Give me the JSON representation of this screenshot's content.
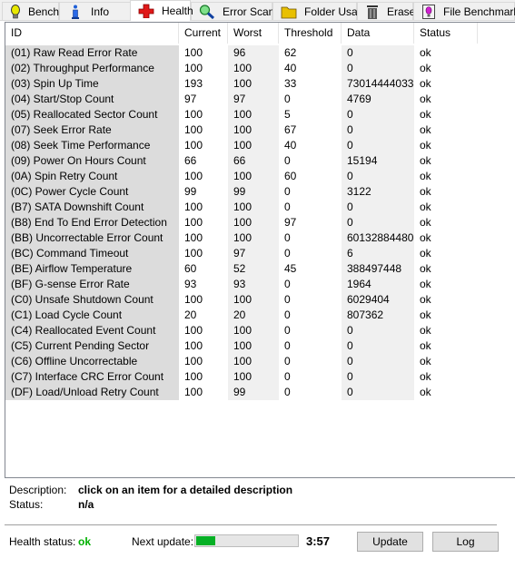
{
  "tabs": [
    {
      "label": "Benchmark",
      "icon": "lightbulb-icon",
      "active": false
    },
    {
      "label": "Info",
      "icon": "info-icon",
      "active": false
    },
    {
      "label": "Health",
      "icon": "health-cross-icon",
      "active": true
    },
    {
      "label": "Error Scan",
      "icon": "magnifier-icon",
      "active": false
    },
    {
      "label": "Folder Usage",
      "icon": "folder-icon",
      "active": false
    },
    {
      "label": "Erase",
      "icon": "trash-icon",
      "active": false
    },
    {
      "label": "File Benchmark",
      "icon": "file-benchmark-icon",
      "active": false
    }
  ],
  "table": {
    "columns": [
      "ID",
      "Current",
      "Worst",
      "Threshold",
      "Data",
      "Status"
    ],
    "rows": [
      [
        "(01) Raw Read Error Rate",
        "100",
        "96",
        "62",
        "0",
        "ok"
      ],
      [
        "(02) Throughput Performance",
        "100",
        "100",
        "40",
        "0",
        "ok"
      ],
      [
        "(03) Spin Up Time",
        "193",
        "100",
        "33",
        "73014444033",
        "ok"
      ],
      [
        "(04) Start/Stop Count",
        "97",
        "97",
        "0",
        "4769",
        "ok"
      ],
      [
        "(05) Reallocated Sector Count",
        "100",
        "100",
        "5",
        "0",
        "ok"
      ],
      [
        "(07) Seek Error Rate",
        "100",
        "100",
        "67",
        "0",
        "ok"
      ],
      [
        "(08) Seek Time Performance",
        "100",
        "100",
        "40",
        "0",
        "ok"
      ],
      [
        "(09) Power On Hours Count",
        "66",
        "66",
        "0",
        "15194",
        "ok"
      ],
      [
        "(0A) Spin Retry Count",
        "100",
        "100",
        "60",
        "0",
        "ok"
      ],
      [
        "(0C) Power Cycle Count",
        "99",
        "99",
        "0",
        "3122",
        "ok"
      ],
      [
        "(B7) SATA Downshift Count",
        "100",
        "100",
        "0",
        "0",
        "ok"
      ],
      [
        "(B8) End To End Error Detection",
        "100",
        "100",
        "97",
        "0",
        "ok"
      ],
      [
        "(BB) Uncorrectable Error Count",
        "100",
        "100",
        "0",
        "60132884480",
        "ok"
      ],
      [
        "(BC) Command Timeout",
        "100",
        "97",
        "0",
        "6",
        "ok"
      ],
      [
        "(BE) Airflow Temperature",
        "60",
        "52",
        "45",
        "388497448",
        "ok"
      ],
      [
        "(BF) G-sense Error Rate",
        "93",
        "93",
        "0",
        "1964",
        "ok"
      ],
      [
        "(C0) Unsafe Shutdown Count",
        "100",
        "100",
        "0",
        "6029404",
        "ok"
      ],
      [
        "(C1) Load Cycle Count",
        "20",
        "20",
        "0",
        "807362",
        "ok"
      ],
      [
        "(C4) Reallocated Event Count",
        "100",
        "100",
        "0",
        "0",
        "ok"
      ],
      [
        "(C5) Current Pending Sector",
        "100",
        "100",
        "0",
        "0",
        "ok"
      ],
      [
        "(C6) Offline Uncorrectable",
        "100",
        "100",
        "0",
        "0",
        "ok"
      ],
      [
        "(C7) Interface CRC Error Count",
        "100",
        "100",
        "0",
        "0",
        "ok"
      ],
      [
        "(DF) Load/Unload Retry Count",
        "100",
        "99",
        "0",
        "0",
        "ok"
      ]
    ]
  },
  "details": {
    "description_label": "Description:",
    "description_value": "click on an item for a detailed description",
    "status_label": "Status:",
    "status_value": "n/a"
  },
  "footer": {
    "health_label": "Health status:",
    "health_value": "ok",
    "health_color": "#00b000",
    "next_update_label": "Next update:",
    "next_update_progress_percent": 20,
    "countdown": "3:57",
    "update_button": "Update",
    "log_button": "Log"
  }
}
